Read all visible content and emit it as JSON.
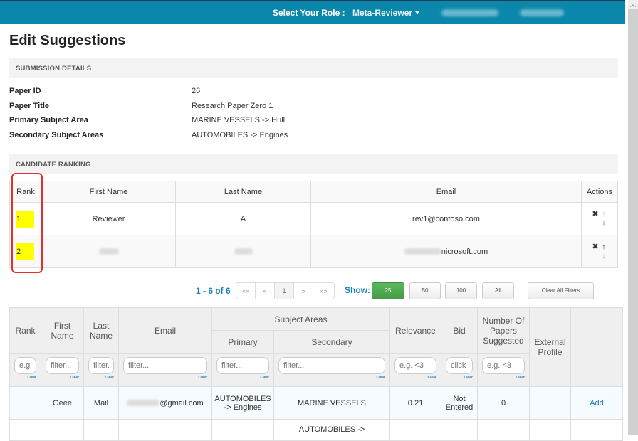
{
  "topbar": {
    "role_label": "Select Your Role :",
    "role_value": "Meta-Reviewer"
  },
  "page_title": "Edit Suggestions",
  "submission": {
    "heading": "SUBMISSION DETAILS",
    "rows": [
      {
        "label": "Paper ID",
        "value": "26"
      },
      {
        "label": "Paper Title",
        "value": "Research Paper Zero 1"
      },
      {
        "label": "Primary Subject Area",
        "value": "MARINE VESSELS -> Hull"
      },
      {
        "label": "Secondary Subject Areas",
        "value": "AUTOMOBILES -> Engines"
      }
    ]
  },
  "ranking": {
    "heading": "CANDIDATE RANKING",
    "columns": [
      "Rank",
      "First Name",
      "Last Name",
      "Email",
      "Actions"
    ],
    "rows": [
      {
        "rank": "1",
        "first": "Reviewer",
        "last": "A",
        "email": "rev1@contoso.com"
      },
      {
        "rank": "2",
        "first": "",
        "last": "",
        "email": "nicrosoft.com"
      }
    ],
    "icons": {
      "remove": "✖",
      "up": "🠑",
      "down": "🠓"
    }
  },
  "pagination": {
    "info": "1 - 6 of 6",
    "buttons": [
      "««",
      "«",
      "1",
      "»",
      "»»"
    ],
    "show_label": "Show:",
    "sizes": [
      "25",
      "50",
      "100",
      "All"
    ],
    "active_size": "25",
    "clear_filters": "Clear All Filters"
  },
  "suggestions": {
    "headers": {
      "rank": "Rank",
      "first": "First Name",
      "last": "Last Name",
      "email": "Email",
      "subject_areas": "Subject Areas",
      "primary": "Primary",
      "secondary": "Secondary",
      "relevance": "Relevance",
      "bid": "Bid",
      "num_papers": "Number Of Papers Suggested",
      "external": "External Profile"
    },
    "filters": {
      "rank": "e.g.",
      "first": "filter...",
      "last": "filter.",
      "email": "filter...",
      "primary": "filter...",
      "secondary": "filter...",
      "relevance": "e.g. <3",
      "bid": "click h",
      "num_papers": "e.g. <3",
      "clear": "Clear"
    },
    "rows": [
      {
        "rank": "",
        "first": "Geee",
        "last": "Mail",
        "email": "@gmail.com",
        "primary": "AUTOMOBILES -> Engines",
        "secondary": "MARINE VESSELS",
        "relevance": "0.21",
        "bid": "Not Entered",
        "num_papers": "0",
        "external": "",
        "action": "Add"
      },
      {
        "rank": "",
        "first": "",
        "last": "",
        "email": "",
        "primary": "",
        "secondary": "AUTOMOBILES ->",
        "relevance": "",
        "bid": "",
        "num_papers": "",
        "external": "",
        "action": ""
      }
    ]
  }
}
